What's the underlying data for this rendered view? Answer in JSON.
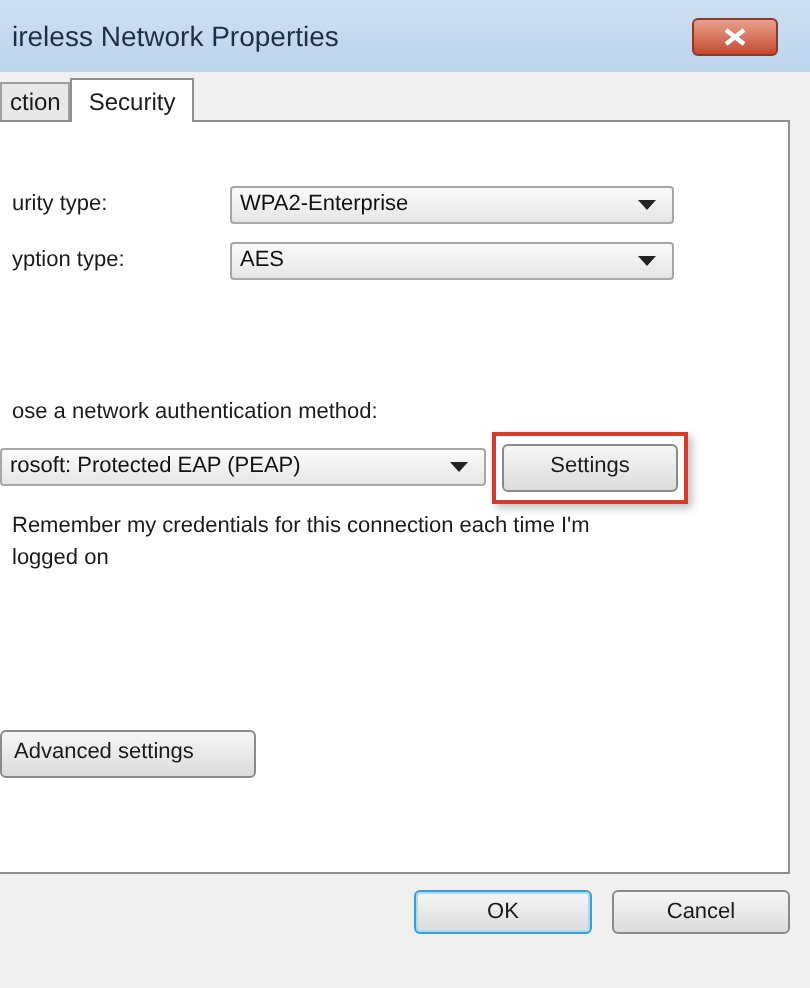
{
  "window": {
    "title": "ireless Network Properties"
  },
  "tabs": [
    {
      "label": "ction",
      "selected": false
    },
    {
      "label": "Security",
      "selected": true
    }
  ],
  "fields": [
    {
      "label": "urity type:",
      "value": "WPA2-Enterprise"
    },
    {
      "label": "yption type:",
      "value": "AES"
    }
  ],
  "auth": {
    "label": "ose a network authentication method:",
    "value": "rosoft: Protected EAP (PEAP)",
    "settings_button": {
      "label": "Settings",
      "highlighted": true
    }
  },
  "remember_text": "Remember my credentials for this connection each time I'm logged on",
  "advanced_button": "Advanced settings",
  "buttons": [
    {
      "label": "OK",
      "selected": true
    },
    {
      "label": "Cancel",
      "selected": false
    }
  ]
}
